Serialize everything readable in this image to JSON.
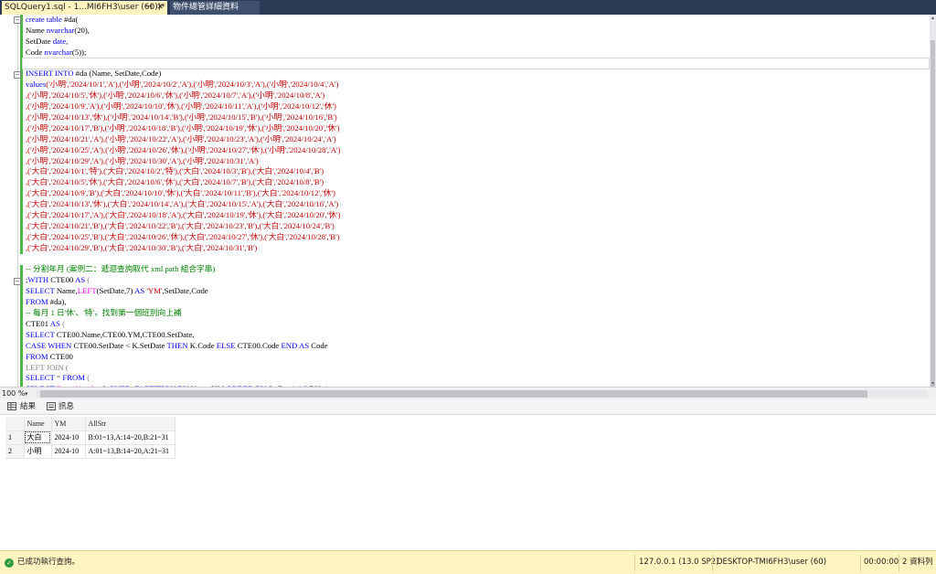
{
  "tabs": {
    "active_label": "SQLQuery1.sql - 1...MI6FH3\\user (60))*",
    "inactive_label": "物件總管詳細資料",
    "pin_glyph": "⊣",
    "close_glyph": "✕"
  },
  "editor": {
    "lines": [
      [
        {
          "t": "create table ",
          "c": "kw"
        },
        {
          "t": "#da(",
          "c": ""
        }
      ],
      [
        {
          "t": "Name ",
          "c": ""
        },
        {
          "t": "nvarchar",
          "c": "kw"
        },
        {
          "t": "(20),",
          "c": ""
        }
      ],
      [
        {
          "t": "SetDate ",
          "c": ""
        },
        {
          "t": "date",
          "c": "kw"
        },
        {
          "t": ",",
          "c": ""
        }
      ],
      [
        {
          "t": "Code ",
          "c": ""
        },
        {
          "t": "nvarchar",
          "c": "kw"
        },
        {
          "t": "(5));",
          "c": ""
        }
      ],
      [],
      [
        {
          "t": "INSERT INTO ",
          "c": "kw"
        },
        {
          "t": "#da (Name, SetDate,Code)",
          "c": ""
        }
      ],
      [
        {
          "t": "values",
          "c": "kw"
        },
        {
          "t": "('小明','2024/10/1','A'),('小明','2024/10/2','A'),('小明','2024/10/3','A'),('小明','2024/10/4','A')",
          "c": "str"
        }
      ],
      [
        {
          "t": ",('小明','2024/10/5','休'),('小明','2024/10/6','休'),('小明','2024/10/7','A'),('小明','2024/10/8','A')",
          "c": "str"
        }
      ],
      [
        {
          "t": ",('小明','2024/10/9','A'),('小明','2024/10/10','休'),('小明','2024/10/11','A'),('小明','2024/10/12','休')",
          "c": "str"
        }
      ],
      [
        {
          "t": ",('小明','2024/10/13','休'),('小明','2024/10/14','B'),('小明','2024/10/15','B'),('小明','2024/10/16','B')",
          "c": "str"
        }
      ],
      [
        {
          "t": ",('小明','2024/10/17','B'),('小明','2024/10/18','B'),('小明','2024/10/19','休'),('小明','2024/10/20','休')",
          "c": "str"
        }
      ],
      [
        {
          "t": ",('小明','2024/10/21','A'),('小明','2024/10/22','A'),('小明','2024/10/23','A'),('小明','2024/10/24','A')",
          "c": "str"
        }
      ],
      [
        {
          "t": ",('小明','2024/10/25','A'),('小明','2024/10/26','休'),('小明','2024/10/27','休'),('小明','2024/10/28','A')",
          "c": "str"
        }
      ],
      [
        {
          "t": ",('小明','2024/10/29','A'),('小明','2024/10/30','A'),('小明','2024/10/31','A')",
          "c": "str"
        }
      ],
      [
        {
          "t": ",('大白','2024/10/1','特'),('大白','2024/10/2','特'),('大白','2024/10/3','B'),('大白','2024/10/4','B')",
          "c": "str"
        }
      ],
      [
        {
          "t": ",('大白','2024/10/5','休'),('大白','2024/10/6','休'),('大白','2024/10/7','B'),('大白','2024/10/8','B')",
          "c": "str"
        }
      ],
      [
        {
          "t": ",('大白','2024/10/9','B'),('大白','2024/10/10','休'),('大白','2024/10/11','B'),('大白','2024/10/12','休')",
          "c": "str"
        }
      ],
      [
        {
          "t": ",('大白','2024/10/13','休'),('大白','2024/10/14','A'),('大白','2024/10/15','A'),('大白','2024/10/16','A')",
          "c": "str"
        }
      ],
      [
        {
          "t": ",('大白','2024/10/17','A'),('大白','2024/10/18','A'),('大白','2024/10/19','休'),('大白','2024/10/20','休')",
          "c": "str"
        }
      ],
      [
        {
          "t": ",('大白','2024/10/21','B'),('大白','2024/10/22','B'),('大白','2024/10/23','B'),('大白','2024/10/24','B')",
          "c": "str"
        }
      ],
      [
        {
          "t": ",('大白','2024/10/25','B'),('大白','2024/10/26','休'),('大白','2024/10/27','休'),('大白','2024/10/28','B')",
          "c": "str"
        }
      ],
      [
        {
          "t": ",('大白','2024/10/29','B'),('大白','2024/10/30','B'),('大白','2024/10/31','B')",
          "c": "str"
        }
      ],
      [],
      [
        {
          "t": "-- 分割年月 (案例二：遞迴查詢取代 xml path 組合字串)",
          "c": "cmt"
        }
      ],
      [
        {
          "t": ";",
          "c": ""
        },
        {
          "t": "WITH ",
          "c": "kw"
        },
        {
          "t": "CTE00 ",
          "c": ""
        },
        {
          "t": "AS ",
          "c": "kw"
        },
        {
          "t": "(",
          "c": "gry"
        }
      ],
      [
        {
          "t": "SELECT ",
          "c": "kw"
        },
        {
          "t": "Name,",
          "c": ""
        },
        {
          "t": "LEFT",
          "c": "fn"
        },
        {
          "t": "(SetDate,7) ",
          "c": ""
        },
        {
          "t": "AS ",
          "c": "kw"
        },
        {
          "t": "'YM'",
          "c": "str"
        },
        {
          "t": ",SetDate,Code",
          "c": ""
        }
      ],
      [
        {
          "t": "FROM ",
          "c": "kw"
        },
        {
          "t": "#da),",
          "c": ""
        }
      ],
      [
        {
          "t": "-- 每月 1 日'休'、'特'，找到第一個班別向上補",
          "c": "cmt"
        }
      ],
      [
        {
          "t": "CTE01 ",
          "c": ""
        },
        {
          "t": "AS ",
          "c": "kw"
        },
        {
          "t": "(",
          "c": "gry"
        }
      ],
      [
        {
          "t": "SELECT ",
          "c": "kw"
        },
        {
          "t": "CTE00.Name,CTE00.YM,CTE00.SetDate,",
          "c": ""
        }
      ],
      [
        {
          "t": "CASE WHEN ",
          "c": "kw"
        },
        {
          "t": "CTE00.SetDate < K.SetDate ",
          "c": ""
        },
        {
          "t": "THEN ",
          "c": "kw"
        },
        {
          "t": "K.Code ",
          "c": ""
        },
        {
          "t": "ELSE ",
          "c": "kw"
        },
        {
          "t": "CTE00.Code ",
          "c": ""
        },
        {
          "t": "END AS ",
          "c": "kw"
        },
        {
          "t": "Code",
          "c": ""
        }
      ],
      [
        {
          "t": "FROM ",
          "c": "kw"
        },
        {
          "t": "CTE00",
          "c": ""
        }
      ],
      [
        {
          "t": "LEFT JOIN (",
          "c": "gry"
        }
      ],
      [
        {
          "t": "SELECT ",
          "c": "kw"
        },
        {
          "t": "* ",
          "c": "gry"
        },
        {
          "t": "FROM ",
          "c": "kw"
        },
        {
          "t": "(",
          "c": "gry"
        }
      ],
      [
        {
          "t": "SELECT ",
          "c": "kw"
        },
        {
          "t": "Row_Number",
          "c": "fn"
        },
        {
          "t": "() ",
          "c": ""
        },
        {
          "t": "OVER ",
          "c": "kw"
        },
        {
          "t": "(",
          "c": "gry"
        },
        {
          "t": "PARTITION BY ",
          "c": "kw"
        },
        {
          "t": "Name,YM ",
          "c": ""
        },
        {
          "t": "ORDER BY ",
          "c": "kw"
        },
        {
          "t": "SetDate) ",
          "c": ""
        },
        {
          "t": "AS ",
          "c": "kw"
        },
        {
          "t": "RN ,*",
          "c": ""
        }
      ]
    ]
  },
  "zoom": {
    "level": "100 %",
    "caret": "▾"
  },
  "result_tabs": {
    "results": "結果",
    "messages": "訊息"
  },
  "grid": {
    "headers": [
      "Name",
      "YM",
      "AllStr"
    ],
    "rows": [
      {
        "num": "1",
        "name": "大白",
        "ym": "2024-10",
        "allstr": "B:01~13,A:14~20,B:21~31"
      },
      {
        "num": "2",
        "name": "小明",
        "ym": "2024-10",
        "allstr": "A:01~13,B:14~20,A:21~31"
      }
    ]
  },
  "status": {
    "ok_glyph": "✓",
    "message": "已成功執行查詢。",
    "server": "127.0.0.1 (13.0 SP2)",
    "user": "DESKTOP-TMI6FH3\\user (60)",
    "time": "00:00:00",
    "rows": "2 資料列"
  }
}
